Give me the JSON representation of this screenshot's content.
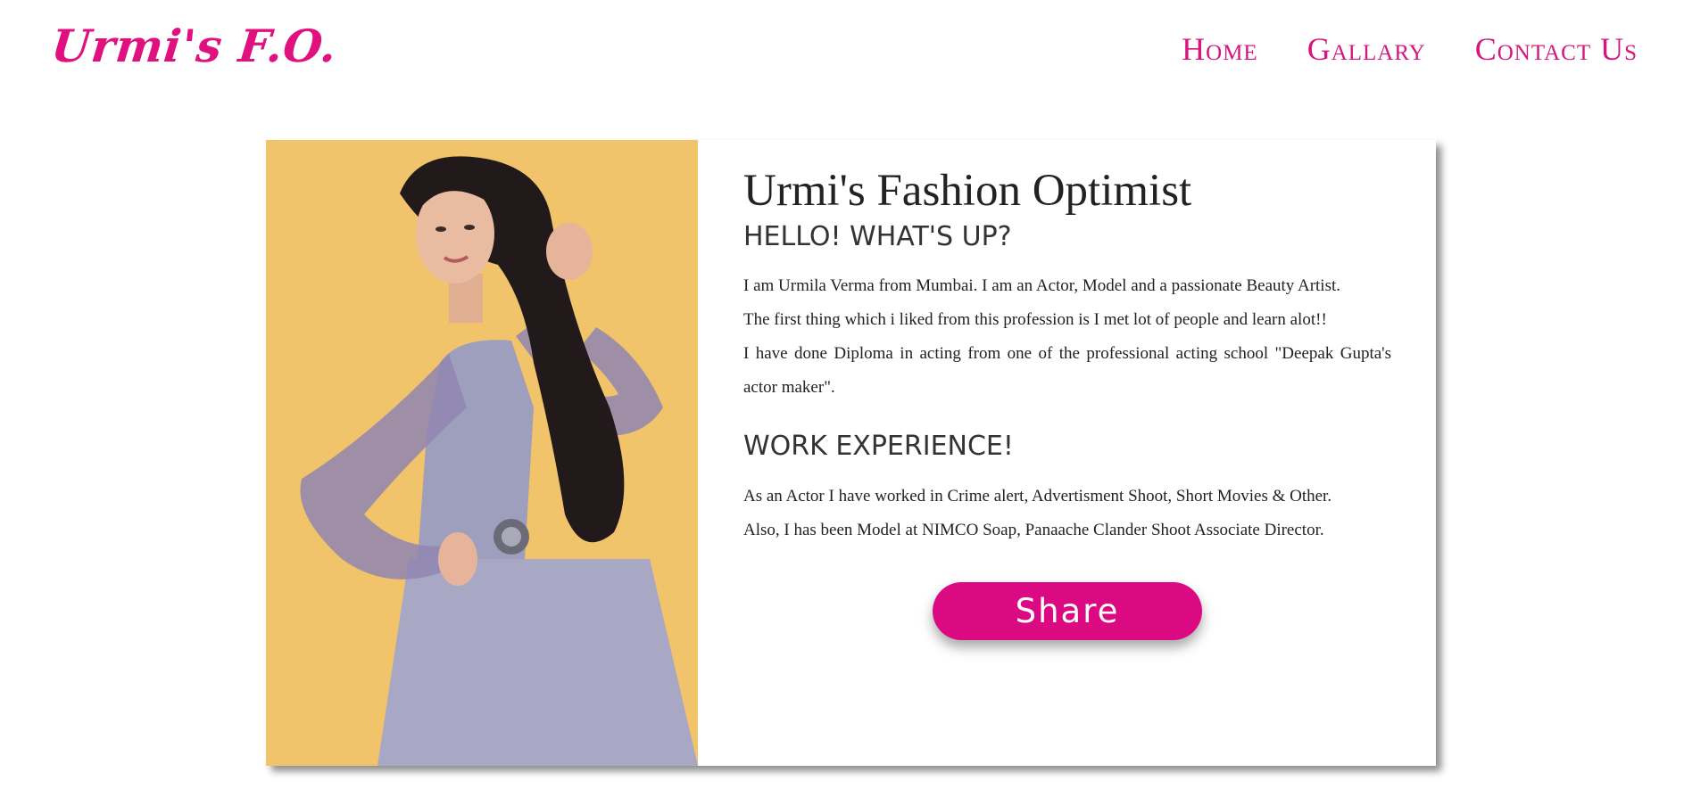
{
  "header": {
    "logo_text": "Urmi's F.O.",
    "nav": [
      {
        "label": "Home"
      },
      {
        "label": "Gallary"
      },
      {
        "label": "Contact Us"
      }
    ]
  },
  "profile": {
    "title": "Urmi's Fashion Optimist",
    "greeting": "HELLO! WHAT'S UP?",
    "bio_lines": [
      "I am Urmila Verma from Mumbai. I am an Actor, Model and a passionate Beauty Artist.",
      "The first thing which i liked from this profession is I met lot of people and learn alot!!",
      "I have done Diploma in acting from one of the professional acting school \"Deepak Gupta's actor maker\"."
    ],
    "work_heading": "WORK EXPERIENCE!",
    "work_lines": [
      "As an Actor I have worked in Crime alert, Advertisment Shoot, Short Movies & Other.",
      "Also, I has been Model at NIMCO Soap, Panaache Clander Shoot Associate Director."
    ],
    "share_label": "Share"
  },
  "colors": {
    "brand_pink": "#e0117e",
    "button_pink": "#dc0a82",
    "photo_background": "#f1c36a",
    "text_dark": "#222222"
  }
}
